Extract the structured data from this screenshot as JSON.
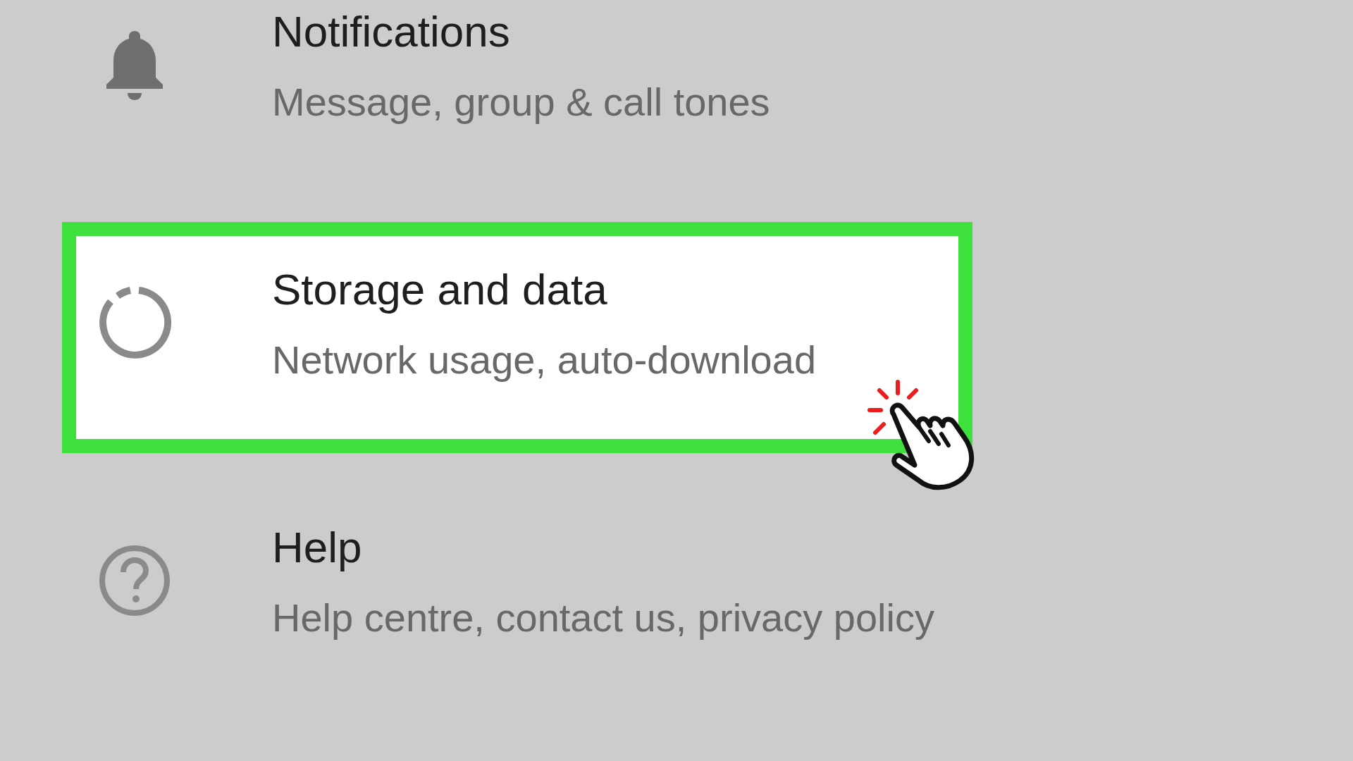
{
  "settings": [
    {
      "title": "Notifications",
      "subtitle": "Message, group & call tones",
      "selected": false
    },
    {
      "title": "Storage and data",
      "subtitle": "Network usage, auto-download",
      "selected": true
    },
    {
      "title": "Help",
      "subtitle": "Help centre, contact us, privacy policy",
      "selected": false
    }
  ]
}
